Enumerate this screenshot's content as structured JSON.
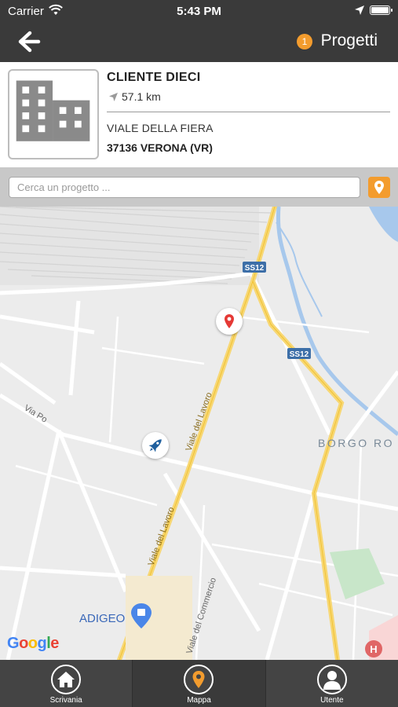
{
  "status_bar": {
    "carrier": "Carrier",
    "time": "5:43 PM"
  },
  "nav": {
    "badge_count": "1",
    "title": "Progetti"
  },
  "client": {
    "name": "CLIENTE DIECI",
    "distance": "57.1 km",
    "address": "VIALE DELLA FIERA",
    "city": "37136 VERONA (VR)"
  },
  "search": {
    "placeholder": "Cerca un progetto ..."
  },
  "map": {
    "labels": {
      "ss12_top": "SS12",
      "ss12_mid": "SS12",
      "via_po": "Via Po",
      "viale_lavoro_top": "Viale del Lavoro",
      "viale_lavoro_bottom": "Viale del Lavoro",
      "viale_commercio": "Viale del Commercio",
      "borgo": "BORGO RO",
      "adigeo": "ADIGEO"
    },
    "google_logo": [
      "G",
      "o",
      "o",
      "g",
      "l",
      "e"
    ]
  },
  "tabs": [
    {
      "label": "Scrivania",
      "icon": "home-icon"
    },
    {
      "label": "Mappa",
      "icon": "map-pin-icon",
      "active": true
    },
    {
      "label": "Utente",
      "icon": "user-icon"
    }
  ],
  "colors": {
    "accent": "#f39c2e",
    "bar": "#3a3a3a",
    "marker_red": "#e53935",
    "marker_blue": "#1f5f9e"
  }
}
